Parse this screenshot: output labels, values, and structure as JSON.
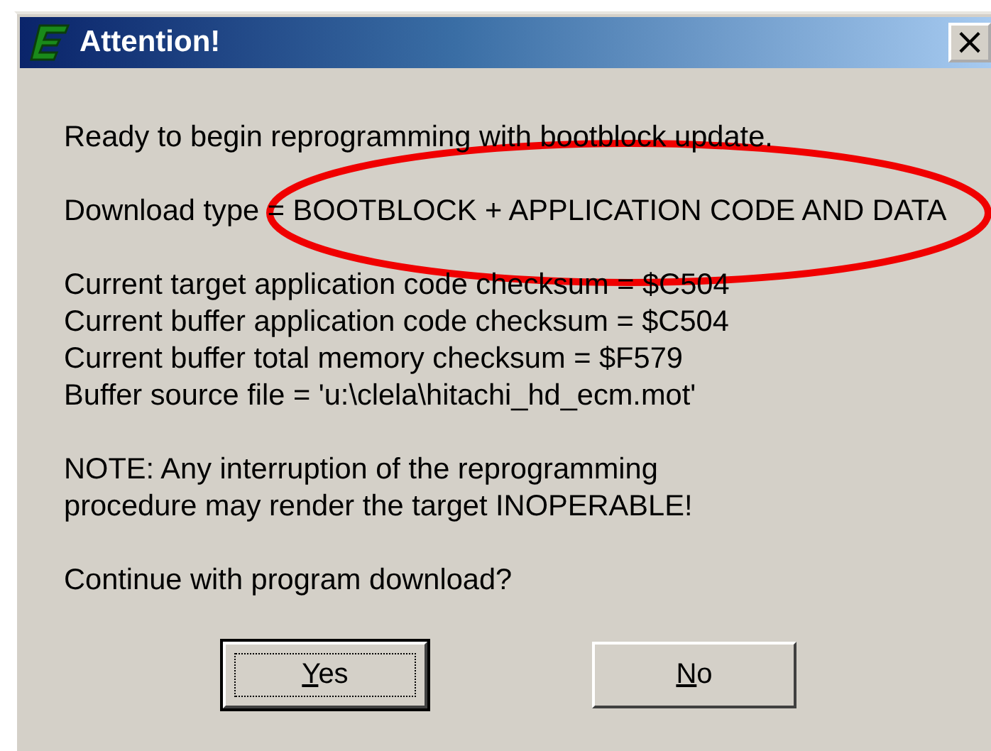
{
  "window": {
    "title": "Attention!",
    "close_label": "×"
  },
  "paragraphs": [
    [
      "Ready to begin reprogramming with bootblock update."
    ],
    [
      "Download type = BOOTBLOCK + APPLICATION CODE AND DATA"
    ],
    [
      "Current target application code checksum = $C504",
      "Current buffer application code checksum = $C504",
      "Current buffer total memory checksum = $F579",
      "Buffer source file = 'u:\\clela\\hitachi_hd_ecm.mot'"
    ],
    [
      "NOTE: Any interruption of the reprogramming",
      "procedure may render the target INOPERABLE!"
    ],
    [
      "Continue with program download?"
    ]
  ],
  "buttons": [
    {
      "mnemonic": "Y",
      "rest": "es",
      "default": true
    },
    {
      "mnemonic": "N",
      "rest": "o",
      "default": false
    }
  ],
  "annotations": [
    {
      "kind": "ellipse"
    }
  ]
}
